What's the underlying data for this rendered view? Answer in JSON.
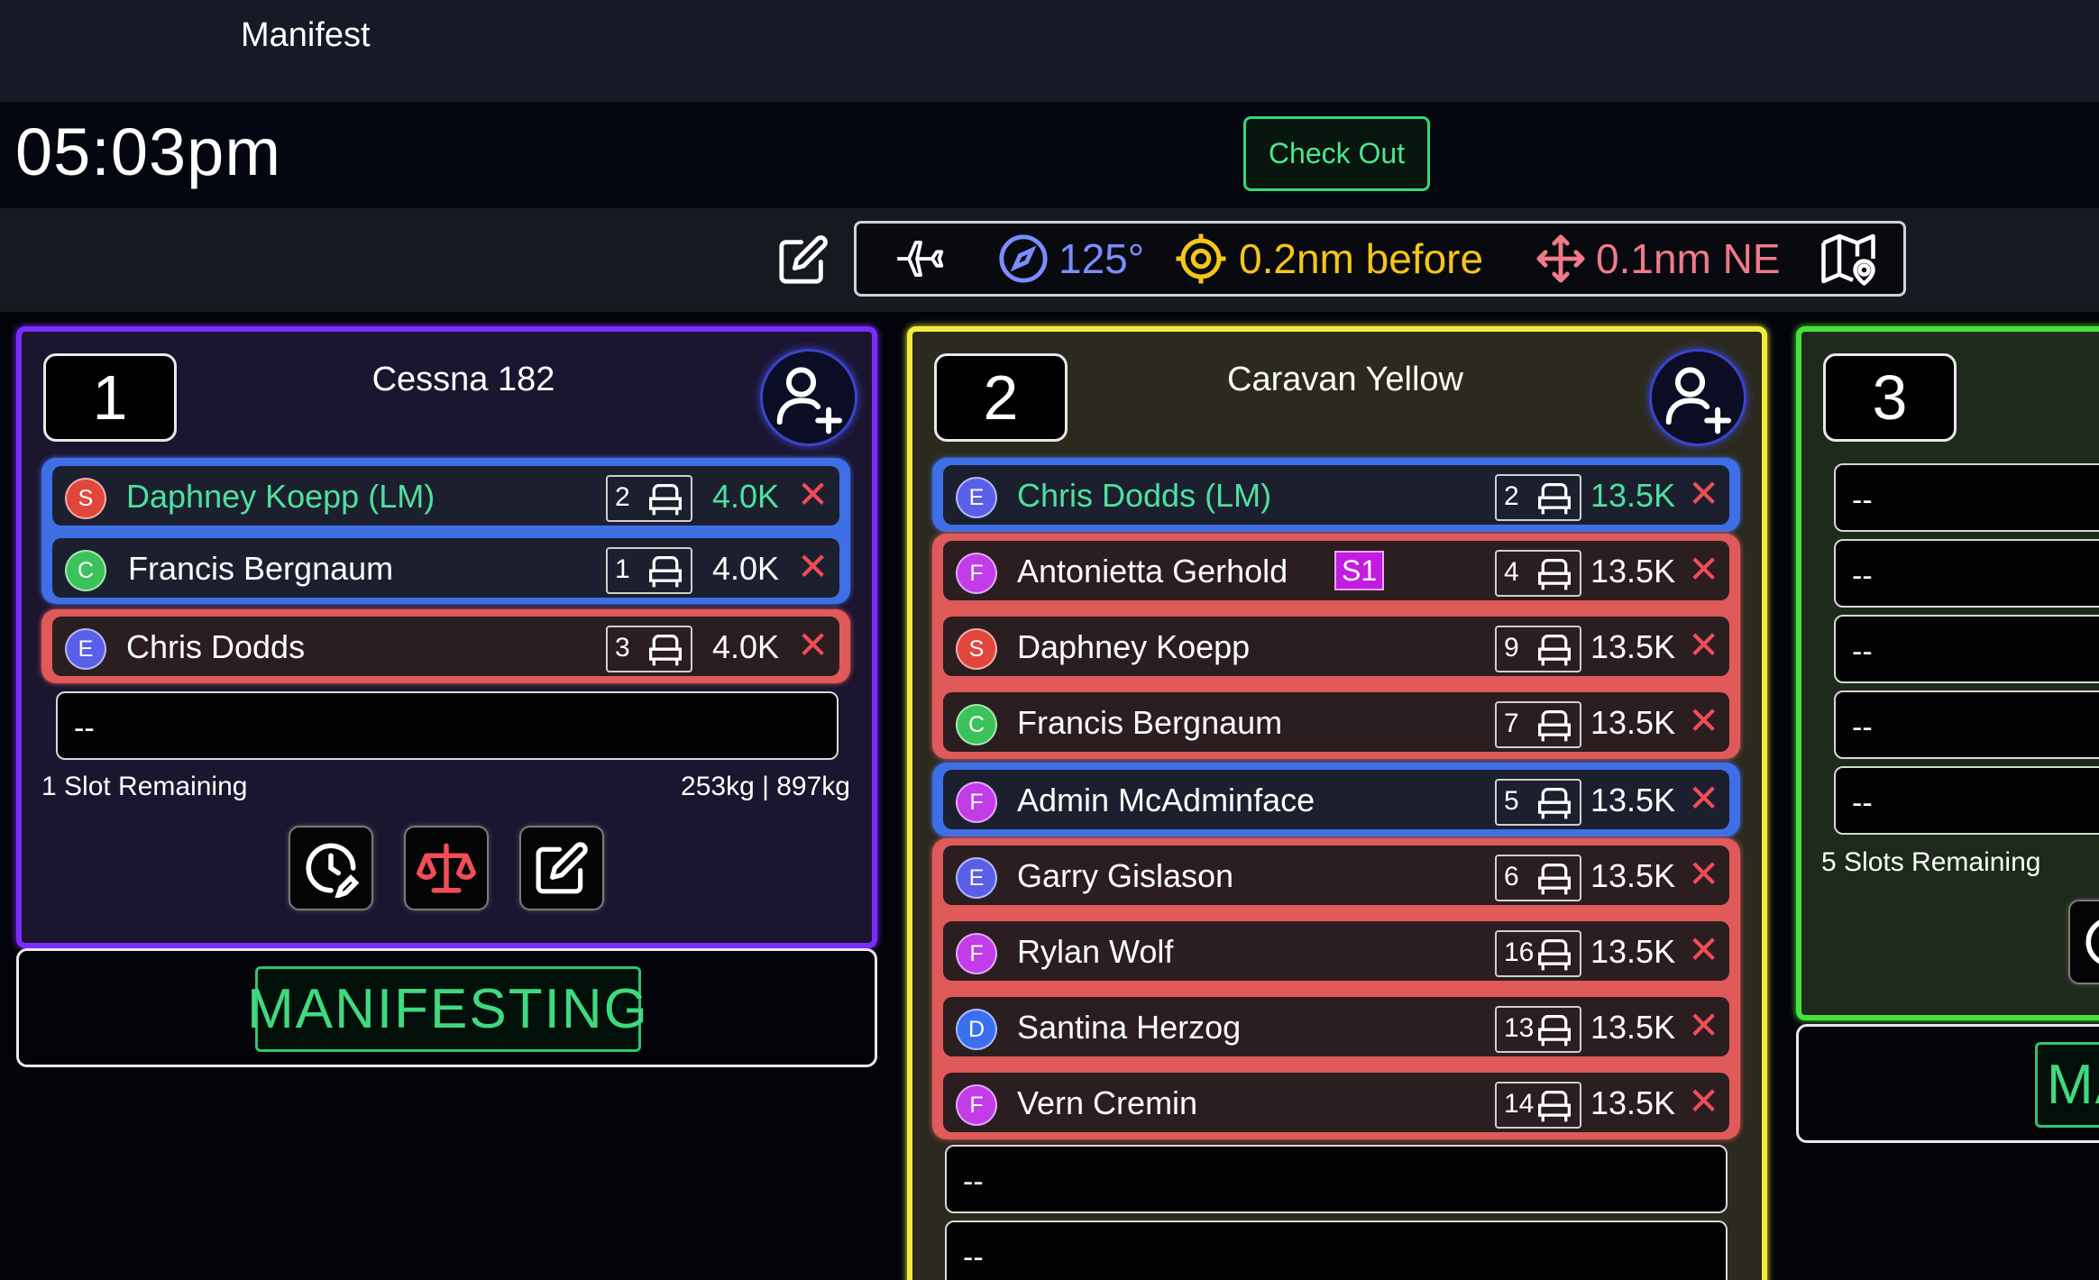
{
  "header": {
    "title": "Manifest"
  },
  "clock": {
    "time": "05:03pm"
  },
  "actions": {
    "check_out": "Check Out"
  },
  "jump_run": {
    "heading": "125°",
    "offset": "0.2nm before",
    "spot": "0.1nm NE",
    "icons": [
      "edit-icon",
      "plane-icon",
      "compass-icon",
      "target-icon",
      "move-icon",
      "map-pin-icon"
    ],
    "colors": {
      "heading": "#7b8cff",
      "offset": "#f5c518",
      "spot": "#f07a8a"
    }
  },
  "loads": [
    {
      "number": "1",
      "aircraft": "Cessna 182",
      "border_color": "#7a2cff",
      "rows": [
        {
          "initial": "S",
          "avatar_color": "#e0463c",
          "name": "Daphney Koepp (LM)",
          "seat": "2",
          "weight": "4.0K",
          "group": "blue",
          "name_color": "#4ee0a0"
        },
        {
          "initial": "C",
          "avatar_color": "#3cc25a",
          "name": "Francis Bergnaum",
          "seat": "1",
          "weight": "4.0K",
          "group": "blue"
        },
        {
          "initial": "E",
          "avatar_color": "#5a5fe8",
          "name": "Chris Dodds",
          "seat": "3",
          "weight": "4.0K",
          "group": "red"
        }
      ],
      "empty_slots": [
        "--"
      ],
      "remaining": "1 Slot Remaining",
      "weights": "253kg | 897kg",
      "status": "MANIFESTING"
    },
    {
      "number": "2",
      "aircraft": "Caravan Yellow",
      "border_color": "#f0ec3c",
      "rows": [
        {
          "initial": "E",
          "avatar_color": "#5a5fe8",
          "name": "Chris Dodds (LM)",
          "seat": "2",
          "weight": "13.5K",
          "group": "blue",
          "name_color": "#4ee0a0"
        },
        {
          "initial": "F",
          "avatar_color": "#c23ce8",
          "name": "Antonietta Gerhold",
          "seat": "4",
          "weight": "13.5K",
          "group": "red",
          "badge": "S1"
        },
        {
          "initial": "S",
          "avatar_color": "#e0463c",
          "name": "Daphney Koepp",
          "seat": "9",
          "weight": "13.5K",
          "group": "red"
        },
        {
          "initial": "C",
          "avatar_color": "#3cc25a",
          "name": "Francis Bergnaum",
          "seat": "7",
          "weight": "13.5K",
          "group": "red"
        },
        {
          "initial": "F",
          "avatar_color": "#c23ce8",
          "name": "Admin McAdminface",
          "seat": "5",
          "weight": "13.5K",
          "group": "blue"
        },
        {
          "initial": "E",
          "avatar_color": "#5a5fe8",
          "name": "Garry Gislason",
          "seat": "6",
          "weight": "13.5K",
          "group": "red"
        },
        {
          "initial": "F",
          "avatar_color": "#c23ce8",
          "name": "Rylan Wolf",
          "seat": "16",
          "weight": "13.5K",
          "group": "red"
        },
        {
          "initial": "D",
          "avatar_color": "#3a6ff0",
          "name": "Santina Herzog",
          "seat": "13",
          "weight": "13.5K",
          "group": "red"
        },
        {
          "initial": "F",
          "avatar_color": "#c23ce8",
          "name": "Vern Cremin",
          "seat": "14",
          "weight": "13.5K",
          "group": "red"
        }
      ],
      "empty_slots": [
        "--",
        "--"
      ]
    },
    {
      "number": "3",
      "border_color": "#46e03c",
      "empty_slots": [
        "--",
        "--",
        "--",
        "--",
        "--"
      ],
      "remaining": "5 Slots Remaining",
      "status": "MA"
    }
  ]
}
